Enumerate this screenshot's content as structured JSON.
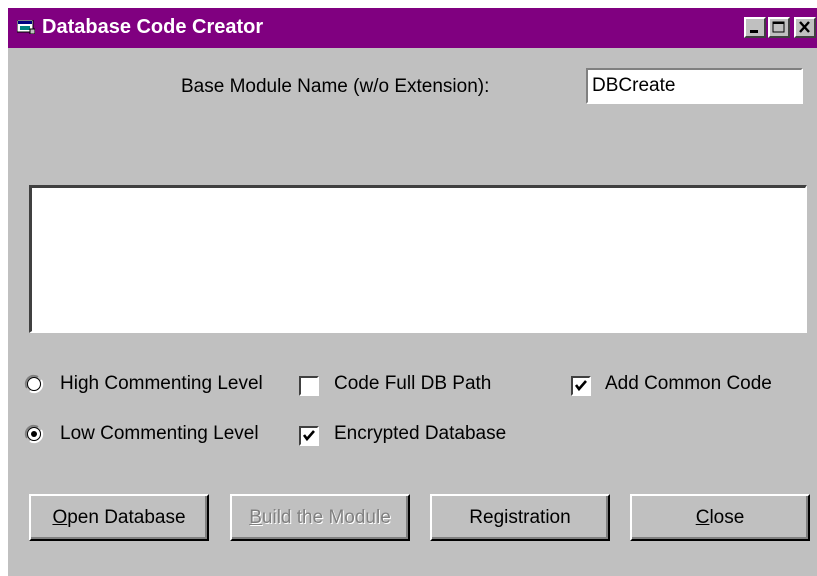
{
  "window": {
    "title": "Database Code Creator",
    "title_bar_color": "#800080",
    "face_color": "#c0c0c0",
    "icon": "database-app-icon",
    "controls": [
      "minimize-icon",
      "maximize-icon",
      "close-icon"
    ]
  },
  "module_name": {
    "label": "Base Module Name (w/o Extension):",
    "value": "DBCreate"
  },
  "output": {
    "text": ""
  },
  "options": {
    "commenting": [
      {
        "label": "High Commenting Level",
        "selected": false
      },
      {
        "label": "Low Commenting Level",
        "selected": true
      }
    ],
    "code_full_db_path": {
      "label": "Code Full DB Path",
      "checked": false
    },
    "encrypted_database": {
      "label": "Encrypted Database",
      "checked": true
    },
    "add_common_code": {
      "label": "Add Common Code",
      "checked": true
    }
  },
  "buttons": {
    "open_database": {
      "mnemonic": "O",
      "rest": "pen Database",
      "enabled": true
    },
    "build_module": {
      "mnemonic": "B",
      "rest": "uild the Module",
      "enabled": false
    },
    "registration": {
      "label": "Registration",
      "enabled": true
    },
    "close": {
      "mnemonic": "C",
      "rest": "lose",
      "enabled": true
    }
  }
}
